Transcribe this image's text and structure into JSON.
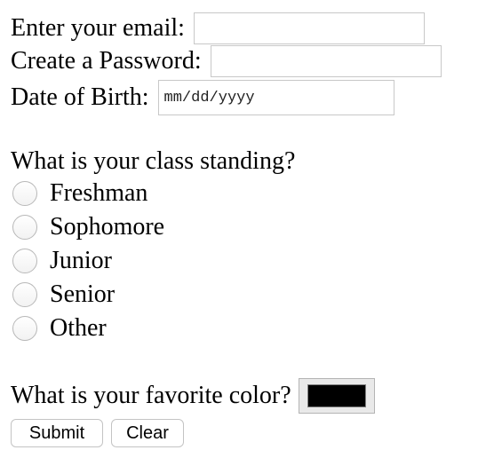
{
  "form": {
    "email_label": "Enter your email:",
    "email_value": "",
    "password_label": "Create a Password:",
    "password_value": "",
    "dob_label": "Date of Birth:",
    "dob_placeholder": "mm/dd/yyyy",
    "standing_question": "What is your class standing?",
    "standing_options": [
      {
        "label": "Freshman",
        "checked": false
      },
      {
        "label": "Sophomore",
        "checked": false
      },
      {
        "label": "Junior",
        "checked": false
      },
      {
        "label": "Senior",
        "checked": false
      },
      {
        "label": "Other",
        "checked": false
      }
    ],
    "color_question": "What is your favorite color?",
    "color_value": "#000000",
    "submit_label": "Submit",
    "clear_label": "Clear"
  }
}
